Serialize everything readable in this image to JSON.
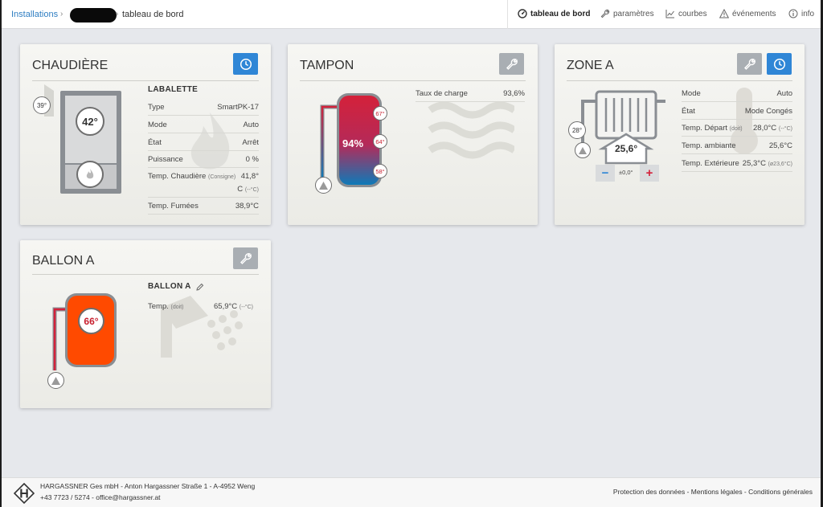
{
  "breadcrumb": {
    "installations": "Installations",
    "separator": "›",
    "current": "tableau de bord"
  },
  "nav": {
    "items": [
      {
        "label": "tableau de bord",
        "icon": "dashboard-icon",
        "active": true
      },
      {
        "label": "paramètres",
        "icon": "wrench-icon",
        "active": false
      },
      {
        "label": "courbes",
        "icon": "chart-icon",
        "active": false
      },
      {
        "label": "événements",
        "icon": "warning-icon",
        "active": false
      },
      {
        "label": "info",
        "icon": "info-icon",
        "active": false
      }
    ]
  },
  "colors": {
    "accent_blue": "#2f86d6",
    "gray_button": "#a9aeb3",
    "hot_red": "#d4213a",
    "ballon_orange": "#ff4a00"
  },
  "chaudiere": {
    "title": "CHAUDIÈRE",
    "name": "LABALETTE",
    "boiler_temp": "42°",
    "outside_temp": "39°",
    "rows": [
      {
        "label": "Type",
        "value": "SmartPK-17"
      },
      {
        "label": "Mode",
        "value": "Auto"
      },
      {
        "label": "État",
        "value": "Arrêt"
      },
      {
        "label": "Puissance",
        "value": "0 %"
      }
    ],
    "temp_label": "Temp. Chaudière",
    "temp_label_small": "(Consigne)",
    "temp_value_1": "41,8°",
    "temp_value_2": "C",
    "temp_value_small": "(--°C)",
    "fumees_label": "Temp. Fumées",
    "fumees_value": "38,9°C"
  },
  "tampon": {
    "title": "TAMPON",
    "charge_percent": "94%",
    "temp_top": "67°",
    "temp_mid": "64°",
    "temp_bottom": "58°",
    "charge_label": "Taux de charge",
    "charge_value": "93,6%"
  },
  "zone_a": {
    "title": "ZONE A",
    "flow_temp": "28°",
    "room_temp": "25,6°",
    "minus": "−",
    "offset": "±0,0°",
    "plus": "+",
    "rows": [
      {
        "label": "Mode",
        "small": "",
        "value": "Auto",
        "value_small": ""
      },
      {
        "label": "État",
        "small": "",
        "value": "Mode Congés",
        "value_small": ""
      },
      {
        "label": "Temp. Départ",
        "small": "(doit)",
        "value": "28,0°C",
        "value_small": "(--°C)"
      },
      {
        "label": "Temp. ambiante",
        "small": "",
        "value": "25,6°C",
        "value_small": ""
      },
      {
        "label": "Temp. Extérieure",
        "small": "",
        "value": "25,3°C",
        "value_small": "(ø23,6°C)"
      }
    ]
  },
  "ballon_a": {
    "title": "BALLON A",
    "name": "BALLON A",
    "tank_temp": "66°",
    "temp_label": "Temp.",
    "temp_label_small": "(doit)",
    "temp_value": "65,9°C",
    "temp_value_small": "(--°C)"
  },
  "footer": {
    "company": "HARGASSNER Ges mbH - Anton Hargassner Straße 1 - A-4952 Weng",
    "contact": "+43 7723 / 5274 - office@hargassner.at",
    "links": "Protection des données - Mentions légales - Conditions générales"
  }
}
